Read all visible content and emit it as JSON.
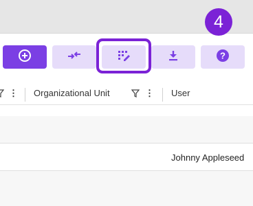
{
  "step_badge": "4",
  "toolbar": {
    "add_icon": "add-circle-icon",
    "compare_icon": "compare-arrows-icon",
    "edit_icon": "grid-edit-icon",
    "download_icon": "download-icon",
    "help_icon": "help-icon"
  },
  "table": {
    "columns": [
      {
        "label": "Organizational Unit"
      },
      {
        "label": "User"
      }
    ],
    "rows": [
      {
        "user": ""
      },
      {
        "user": "Johnny Appleseed"
      },
      {
        "user": ""
      }
    ]
  },
  "colors": {
    "accent": "#7b3fe4",
    "accent_light": "#e6dcfa",
    "highlight": "#7b22d6"
  }
}
